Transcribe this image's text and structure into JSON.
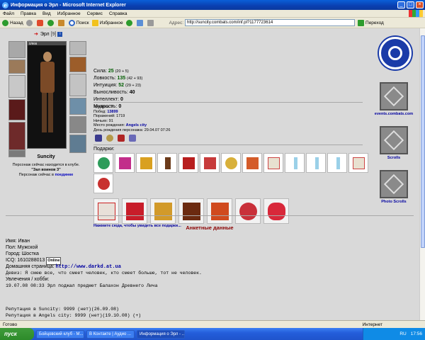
{
  "window": {
    "title": "Информация о Эрл - Microsoft Internet Explorer",
    "min": "_",
    "max": "□",
    "close": "×"
  },
  "menu": [
    "Файл",
    "Правка",
    "Вид",
    "Избранное",
    "Сервис",
    "Справка"
  ],
  "toolbar": {
    "back": "Назад",
    "search": "Поиск",
    "favorites": "Избранное",
    "address_label": "Адрес:",
    "address": "http://suncity.combats.com/inf.pl?1177723614",
    "go": "Переход"
  },
  "character": {
    "name": "Эрл",
    "level": "[9]",
    "info_icon": "i",
    "hp": "0/966",
    "city": "Suncity",
    "status_note": "Персонаж сейчас находится в клубе.",
    "location_label": "\"Зал воинов 3\"",
    "online_note": "Персонаж сейчас в",
    "online_link": "поединке"
  },
  "stats": [
    {
      "label": "Сила:",
      "value": "25",
      "extra": "(20 + 5)"
    },
    {
      "label": "Ловкость:",
      "value": "135",
      "extra": "(42 + 93)"
    },
    {
      "label": "Интуиция:",
      "value": "52",
      "extra": "(29 + 23)"
    },
    {
      "label": "Выносливость:",
      "value": "40",
      "extra": ""
    },
    {
      "label": "Интеллект:",
      "value": "0",
      "extra": ""
    },
    {
      "label": "Мудрость:",
      "value": "0",
      "extra": ""
    }
  ],
  "info": {
    "level": "Уровень: 9",
    "wins_label": "Побед:",
    "wins": "13899",
    "losses": "Поражений: 1719",
    "draws": "Ничьих: 91",
    "birthplace_label": "Место рождения:",
    "birthplace": "Angels city",
    "birthday": "День рождения персонажа: 29.04.07 07:26"
  },
  "gifts": {
    "title": "Подарки:",
    "more_link": "Нажмите сюда, чтобы увидеть все подарки..."
  },
  "right_panel": {
    "events": "events.combats.com",
    "scrolls": "Scrolls",
    "photo_scrolls": "Photo Scrolls"
  },
  "profile": {
    "title": "Анкетные данные",
    "name": "Имя: Иван",
    "sex": "Пол: Мужской",
    "city": "Город: Шостка",
    "icq": "ICQ: 1610288013",
    "online": "Online",
    "homepage_label": "Домашняя страница:",
    "homepage": "http://www.darkd.at.ua",
    "motto": "Девиз: Я смею все, что смеет человек, кто смеет больше, тот не человек.",
    "hobby": "Увлечения / хобби:",
    "hobby_text": "19.07.08 08:33 Эрл поджал предмет Балахон Древнего Лича",
    "rep1": "Репутация в Suncity: 9999 (нет)(26.09.08)",
    "rep2": "Репутация в Angels city: 9999 (нет)(19.10.08) (+)"
  },
  "status": {
    "text": "Готово",
    "zone": "Интернет"
  },
  "taskbar": {
    "start": "пуск",
    "tasks": [
      "Бойцовский клуб - M...",
      "В Контакте | Аудио ...",
      "Информация о Эрл - ..."
    ],
    "lang": "RU",
    "time": "17:56"
  }
}
